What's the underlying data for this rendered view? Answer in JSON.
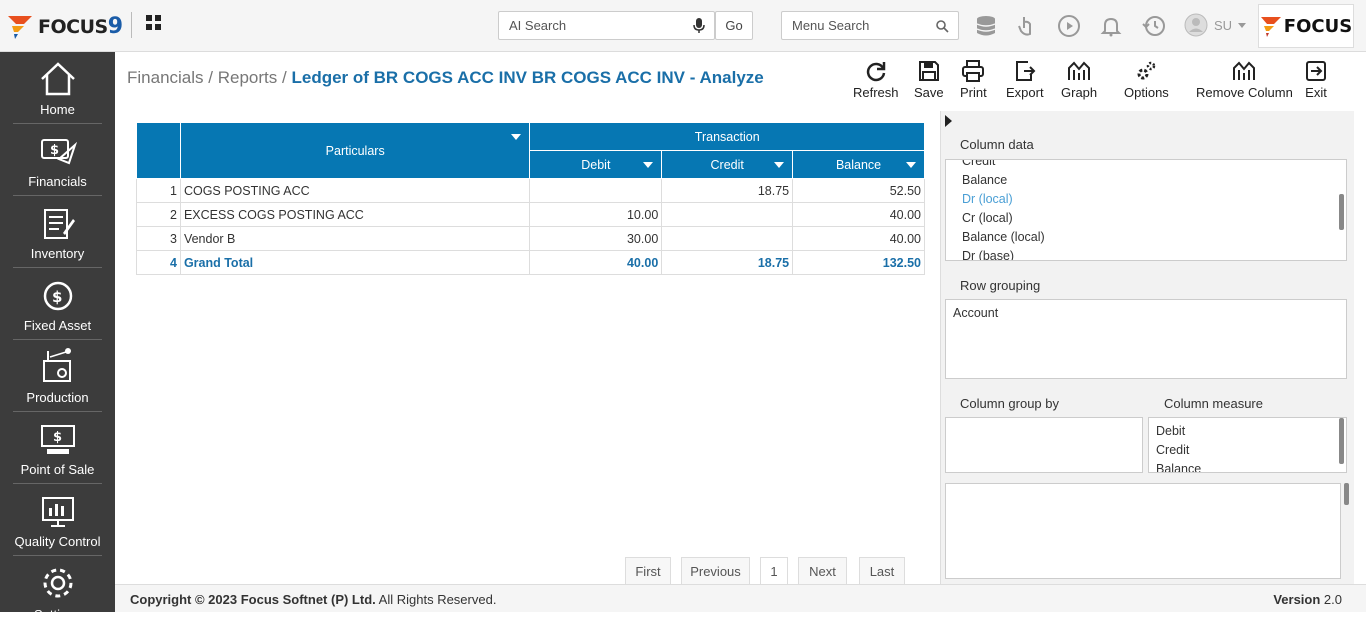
{
  "brand": {
    "name": "FOCUS",
    "version_glyph": "9",
    "right_name": "FOCUS"
  },
  "search": {
    "ai_placeholder": "AI Search",
    "go_label": "Go",
    "menu_placeholder": "Menu Search"
  },
  "user": {
    "initials": "SU"
  },
  "sidebar": {
    "items": [
      {
        "label": "Home"
      },
      {
        "label": "Financials"
      },
      {
        "label": "Inventory"
      },
      {
        "label": "Fixed Asset"
      },
      {
        "label": "Production"
      },
      {
        "label": "Point of Sale"
      },
      {
        "label": "Quality Control"
      },
      {
        "label": "Settings"
      }
    ]
  },
  "breadcrumb": {
    "part1": "Financials",
    "sep": "/",
    "part2": "Reports",
    "current": "Ledger of BR COGS ACC INV BR COGS ACC INV - Analyze"
  },
  "toolbar": {
    "refresh": "Refresh",
    "save": "Save",
    "print": "Print",
    "export": "Export",
    "graph": "Graph",
    "options": "Options",
    "remove_column": "Remove Column",
    "exit": "Exit"
  },
  "table": {
    "headers": {
      "particulars": "Particulars",
      "group": "Transaction",
      "debit": "Debit",
      "credit": "Credit",
      "balance": "Balance"
    },
    "rows": [
      {
        "no": "1",
        "particulars": "COGS POSTING ACC",
        "debit": "",
        "credit": "18.75",
        "balance": "52.50"
      },
      {
        "no": "2",
        "particulars": "EXCESS COGS POSTING ACC",
        "debit": "10.00",
        "credit": "",
        "balance": "40.00"
      },
      {
        "no": "3",
        "particulars": "Vendor B",
        "debit": "30.00",
        "credit": "",
        "balance": "40.00"
      },
      {
        "no": "4",
        "particulars": "Grand Total",
        "debit": "40.00",
        "credit": "18.75",
        "balance": "132.50"
      }
    ]
  },
  "pager": {
    "first": "First",
    "previous": "Previous",
    "page": "1",
    "next": "Next",
    "last": "Last"
  },
  "panel": {
    "column_data_label": "Column data",
    "column_data": [
      "Credit",
      "Balance",
      "Dr (local)",
      "Cr (local)",
      "Balance (local)",
      "Dr (base)"
    ],
    "row_grouping_label": "Row grouping",
    "row_grouping": [
      "Account"
    ],
    "column_group_by_label": "Column group by",
    "column_measure_label": "Column measure",
    "column_measure": [
      "Debit",
      "Credit",
      "Balance"
    ]
  },
  "footer": {
    "copyright": "Copyright © 2023 Focus Softnet (P) Ltd.",
    "rights": "All Rights Reserved.",
    "version_label": "Version",
    "version": "2.0"
  },
  "colors": {
    "accent": "#0677b3",
    "sidebar": "#3c3c3c",
    "link": "#1a6fa8"
  }
}
